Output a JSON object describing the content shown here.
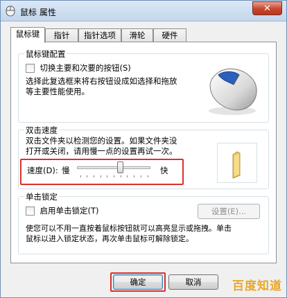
{
  "window": {
    "title": "鼠标 属性",
    "close_glyph": "✕"
  },
  "tabs": [
    {
      "label": "鼠标键",
      "active": true
    },
    {
      "label": "指针",
      "active": false
    },
    {
      "label": "指针选项",
      "active": false
    },
    {
      "label": "滑轮",
      "active": false
    },
    {
      "label": "硬件",
      "active": false
    }
  ],
  "button_config": {
    "legend": "鼠标键配置",
    "checkbox_label": "切换主要和次要的按钮(S)",
    "checked": false,
    "description_line1": "选择此复选框来将右按钮设成如选择和拖放",
    "description_line2": "等主要性能使用。",
    "image_icon": "mouse-icon"
  },
  "double_click": {
    "legend": "双击速度",
    "description_line1": "双击文件夹以检测您的设置。如果文件夹没",
    "description_line2": "打开或关闭，请用慢一点的设置再试一次。",
    "speed_label": "速度(D):",
    "slow_label": "慢",
    "fast_label": "快",
    "speed_value": 0.6,
    "folder_icon": "folder-icon"
  },
  "click_lock": {
    "legend": "单击锁定",
    "checkbox_label": "启用单击锁定(T)",
    "checked": false,
    "settings_button": "设置(E)...",
    "description_line1": "使您可以不用一直按着鼠标按钮就可以高亮显示或拖拽。单击",
    "description_line2": "鼠标以进入锁定状态，再次单击鼠标可解除锁定。"
  },
  "buttons": {
    "ok": "确定",
    "cancel": "取消"
  },
  "watermark": "百度知道",
  "colors": {
    "highlight": "#d9302a",
    "close": "#c8452c"
  }
}
